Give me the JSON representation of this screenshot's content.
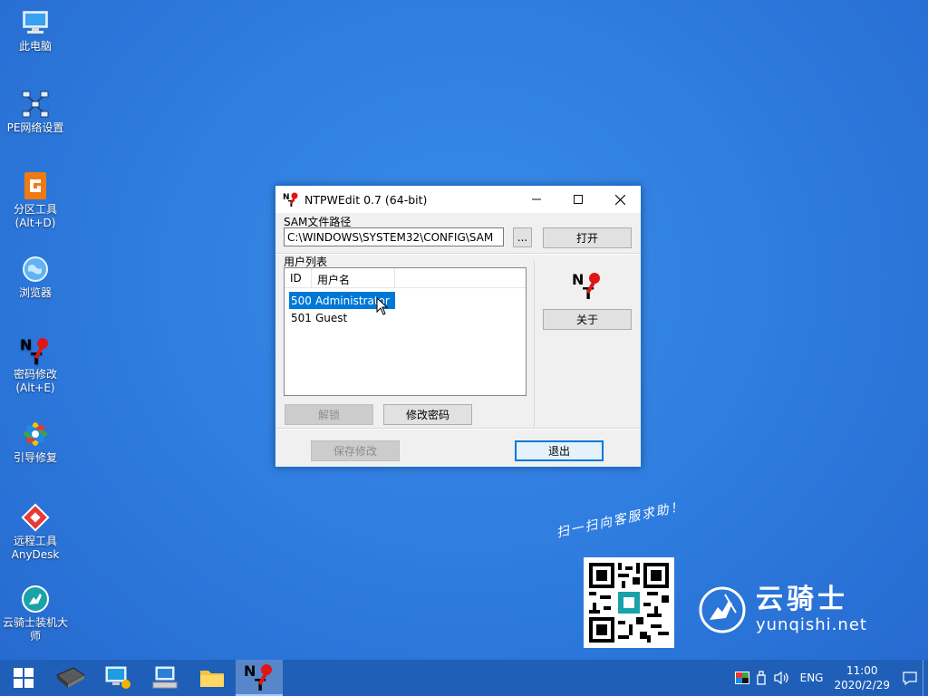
{
  "desktop": {
    "icons": [
      {
        "label": "此电脑"
      },
      {
        "label": "PE网络设置"
      },
      {
        "label": "分区工具\n(Alt+D)"
      },
      {
        "label": "浏览器"
      },
      {
        "label": "密码修改\n(Alt+E)"
      },
      {
        "label": "引导修复"
      },
      {
        "label": "远程工具\nAnyDesk"
      },
      {
        "label": "云骑士装机大\n师"
      }
    ]
  },
  "window": {
    "title": "NTPWEdit 0.7 (64-bit)",
    "sam_group_label": "SAM文件路径",
    "sam_path": "C:\\WINDOWS\\SYSTEM32\\CONFIG\\SAM",
    "browse_label": "...",
    "open_label": "打开",
    "user_list_label": "用户列表",
    "columns": [
      "ID",
      "用户名"
    ],
    "users": [
      {
        "id": "500",
        "name": "Administrator",
        "selected": true
      },
      {
        "id": "501",
        "name": "Guest",
        "selected": false
      }
    ],
    "about_label": "关于",
    "unlock_label": "解锁",
    "change_password_label": "修改密码",
    "save_label": "保存修改",
    "exit_label": "退出"
  },
  "promo": {
    "qr_caption": "扫一扫向客服求助！",
    "brand_name": "云骑士",
    "brand_url": "yunqishi.net"
  },
  "taskbar": {
    "language": "ENG",
    "time": "11:00",
    "date": "2020/2/29"
  },
  "colors": {
    "desktop": "#2f7ee0",
    "taskbar": "#1f5fb8",
    "selection": "#0078d7",
    "window_border": "#1a73d8"
  }
}
